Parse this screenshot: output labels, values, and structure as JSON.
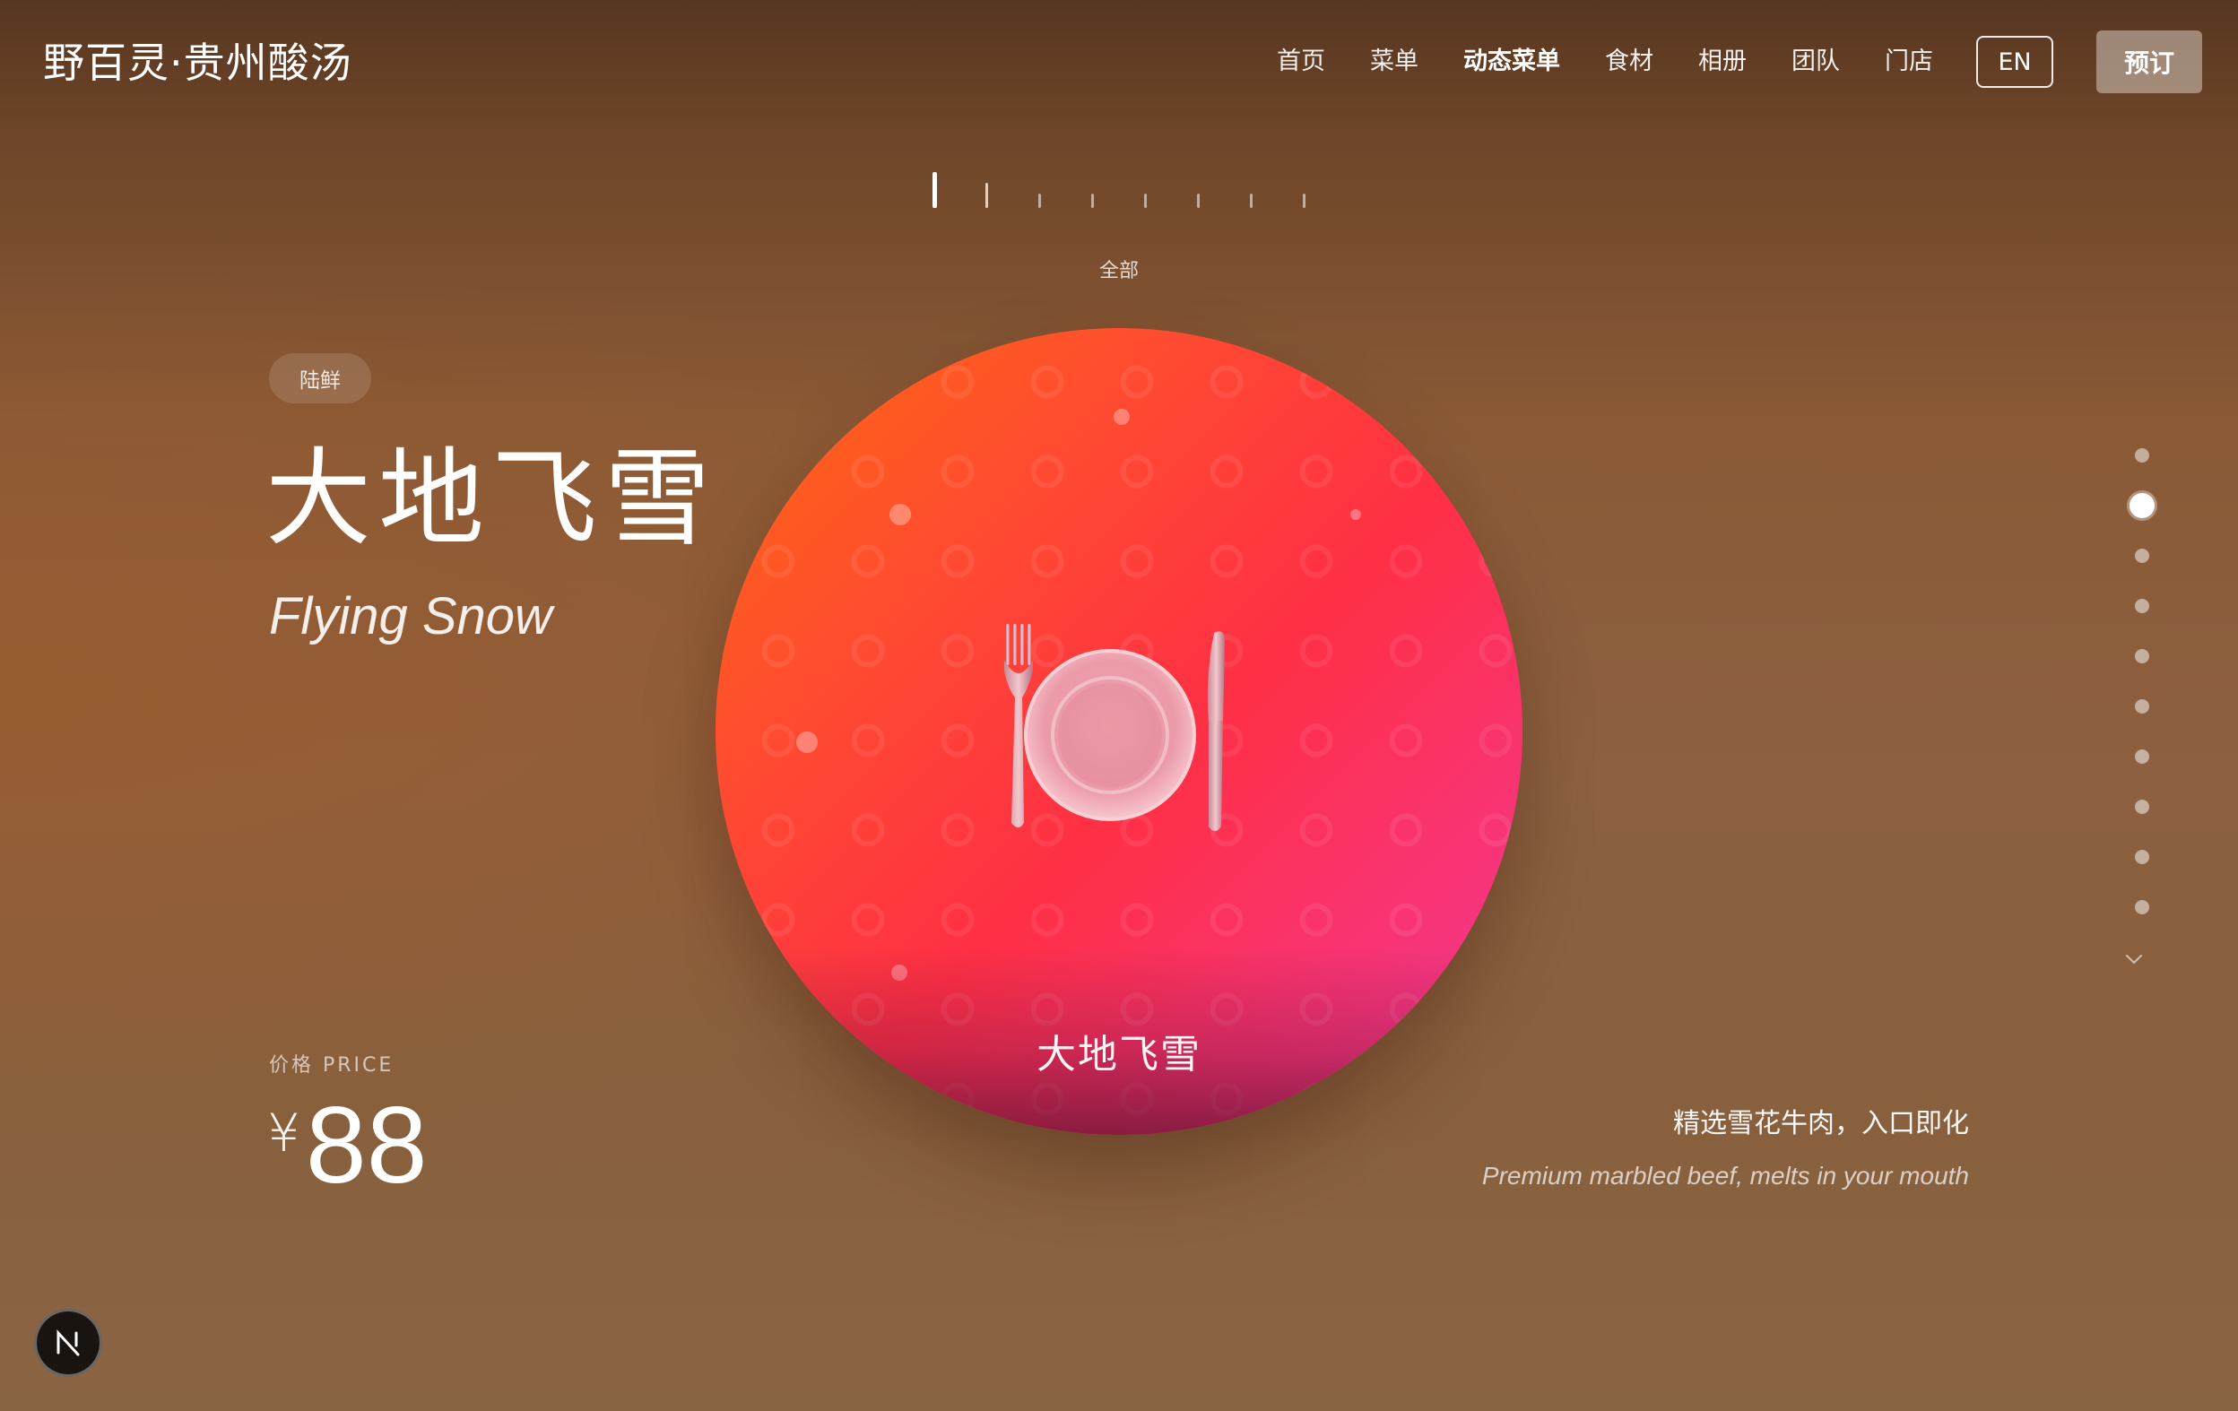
{
  "header": {
    "brand": "野百灵·贵州酸汤",
    "nav": [
      "首页",
      "菜单",
      "动态菜单",
      "食材",
      "相册",
      "团队",
      "门店"
    ],
    "active_nav": "动态菜单",
    "lang_button": "EN",
    "reserve_button": "预订"
  },
  "categories": {
    "current_label": "全部",
    "tick_count": 8,
    "active_index": 0
  },
  "dish": {
    "tag": "陆鲜",
    "title_cn": "大地飞雪",
    "title_en": "Flying Snow",
    "price_label": "价格 PRICE",
    "currency": "¥",
    "price": "88",
    "plate_label": "大地飞雪",
    "description_cn": "精选雪花牛肉，入口即化",
    "description_en": "Premium marbled beef, melts in your mouth"
  },
  "pagination": {
    "total": 10,
    "active_index": 1
  },
  "badge": {
    "letter": "N"
  },
  "colors": {
    "plate_gradient": [
      "#ff6a10",
      "#ff2f45",
      "#ee3a92"
    ],
    "background": "#8a5a36"
  }
}
